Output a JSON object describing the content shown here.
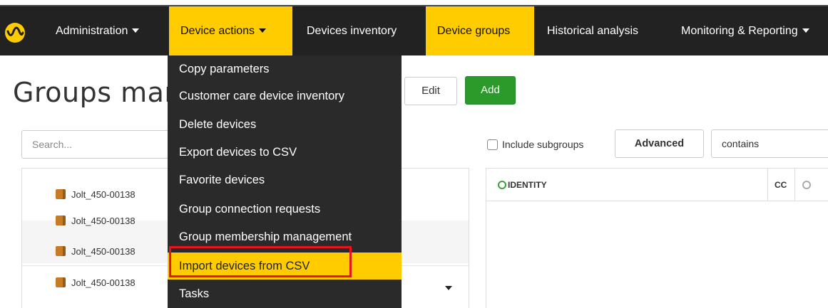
{
  "nav": {
    "items": [
      {
        "label": "Administration",
        "caret": true,
        "active": false
      },
      {
        "label": "Device actions",
        "caret": true,
        "active": true
      },
      {
        "label": "Devices inventory",
        "caret": false,
        "active": false
      },
      {
        "label": "Device groups",
        "caret": false,
        "active": true
      },
      {
        "label": "Historical analysis",
        "caret": false,
        "active": false
      },
      {
        "label": "Monitoring & Reporting",
        "caret": true,
        "active": false
      }
    ]
  },
  "dropdown": {
    "items": [
      "Copy parameters",
      "Customer care device inventory",
      "Delete devices",
      "Export devices to CSV",
      "Favorite devices",
      "Group connection requests",
      "Group membership management",
      "Import devices from CSV",
      "Tasks"
    ],
    "highlighted": "Import devices from CSV"
  },
  "page": {
    "title": "Groups mar",
    "edit_label": "Edit",
    "add_label": "Add",
    "search_placeholder": "Search...",
    "tree_items": [
      "Jolt_450-00138",
      "Jolt_450-00138",
      "Jolt_450-00138",
      "Jolt_450-00138"
    ]
  },
  "filters": {
    "include_subgroups": "Include subgroups",
    "advanced_label": "Advanced",
    "operator": "contains"
  },
  "table": {
    "columns": [
      "IDENTITY",
      "CC"
    ]
  },
  "colors": {
    "accent": "#ffcc00",
    "navbar": "#222222",
    "add_button": "#2b9a2b",
    "highlight_box": "#e8131b"
  }
}
